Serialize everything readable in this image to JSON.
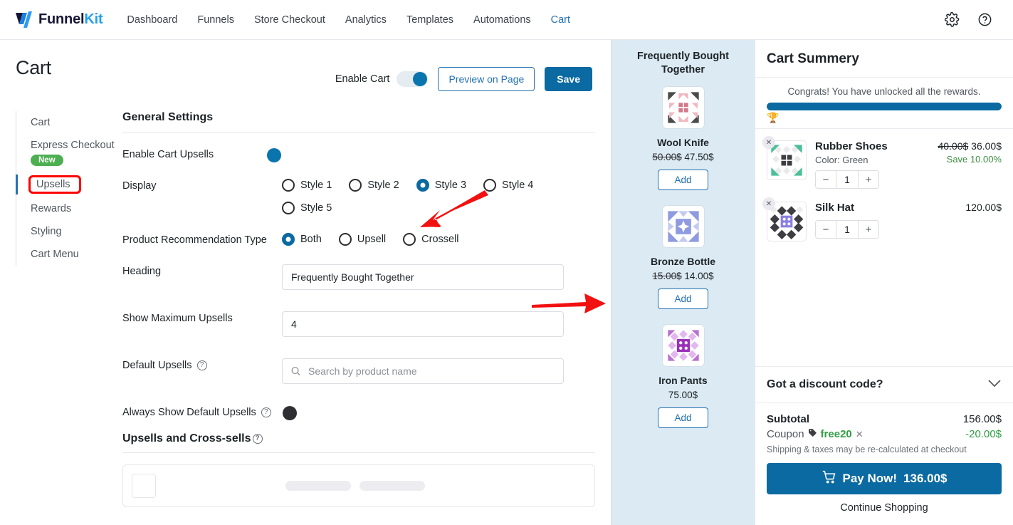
{
  "topnav": {
    "brand": {
      "funnel": "Funnel",
      "kit": "Kit"
    },
    "items": [
      {
        "label": "Dashboard",
        "active": false
      },
      {
        "label": "Funnels",
        "active": false
      },
      {
        "label": "Store Checkout",
        "active": false
      },
      {
        "label": "Analytics",
        "active": false
      },
      {
        "label": "Templates",
        "active": false
      },
      {
        "label": "Automations",
        "active": false
      },
      {
        "label": "Cart",
        "active": true
      }
    ],
    "right_icons": [
      "gear-icon",
      "help-icon"
    ]
  },
  "page": {
    "title": "Cart",
    "enable_cart_label": "Enable Cart",
    "enable_cart_on": true,
    "preview_button": "Preview on Page",
    "save_button": "Save"
  },
  "sidebar": {
    "items": [
      {
        "label": "Cart",
        "active": false,
        "badge": null,
        "highlighted": false
      },
      {
        "label": "Express Checkout",
        "active": false,
        "badge": "New",
        "highlighted": false
      },
      {
        "label": "Upsells",
        "active": true,
        "badge": null,
        "highlighted": true
      },
      {
        "label": "Rewards",
        "active": false,
        "badge": null,
        "highlighted": false
      },
      {
        "label": "Styling",
        "active": false,
        "badge": null,
        "highlighted": false
      },
      {
        "label": "Cart Menu",
        "active": false,
        "badge": null,
        "highlighted": false
      }
    ]
  },
  "settings": {
    "section_title": "General Settings",
    "enable_upsells_label": "Enable Cart Upsells",
    "enable_upsells_on": true,
    "display_label": "Display",
    "display_options": [
      "Style 1",
      "Style 2",
      "Style 3",
      "Style 4",
      "Style 5"
    ],
    "display_selected": "Style 3",
    "recommendation_label": "Product Recommendation Type",
    "recommendation_options": [
      "Both",
      "Upsell",
      "Crossell"
    ],
    "recommendation_selected": "Both",
    "heading_label": "Heading",
    "heading_value": "Frequently Bought Together",
    "max_upsells_label": "Show Maximum Upsells",
    "max_upsells_value": "4",
    "default_upsells_label": "Default Upsells",
    "default_upsells_placeholder": "Search by product name",
    "default_upsells_value": "",
    "always_show_label": "Always Show Default Upsells",
    "always_show_on": false,
    "subsection_title": "Upsells and Cross-sells"
  },
  "upsell_preview": {
    "heading": "Frequently Bought Together",
    "add_label": "Add",
    "products": [
      {
        "name": "Wool Knife",
        "old_price": "50.00$",
        "price": "47.50$",
        "thumb": "wool-knife-thumbnail"
      },
      {
        "name": "Bronze Bottle",
        "old_price": "15.00$",
        "price": "14.00$",
        "thumb": "bronze-bottle-thumbnail"
      },
      {
        "name": "Iron Pants",
        "old_price": "",
        "price": "75.00$",
        "thumb": "iron-pants-thumbnail"
      }
    ]
  },
  "cart_summary": {
    "title": "Cart Summery",
    "reward_text": "Congrats! You have unlocked all the rewards.",
    "progress_percent": 100,
    "trophy_icon": "trophy-icon",
    "items": [
      {
        "name": "Rubber Shoes",
        "variant": "Color: Green",
        "old_price": "40.00$",
        "price": "36.00$",
        "save": "Save 10.00%",
        "qty": "1",
        "thumb": "rubber-shoes-thumbnail"
      },
      {
        "name": "Silk Hat",
        "variant": "",
        "old_price": "",
        "price": "120.00$",
        "save": "",
        "qty": "1",
        "thumb": "silk-hat-thumbnail"
      }
    ],
    "discount_label": "Got a discount code?",
    "subtotal_label": "Subtotal",
    "subtotal_value": "156.00$",
    "coupon_label": "Coupon",
    "coupon_code": "free20",
    "coupon_value": "-20.00$",
    "note": "Shipping & taxes may be re-calculated at checkout",
    "pay_label": "Pay Now!",
    "pay_amount": "136.00$",
    "continue_label": "Continue Shopping"
  },
  "annotations": {
    "arrow_color": "#f21111",
    "highlight_color": "#ff0000"
  }
}
